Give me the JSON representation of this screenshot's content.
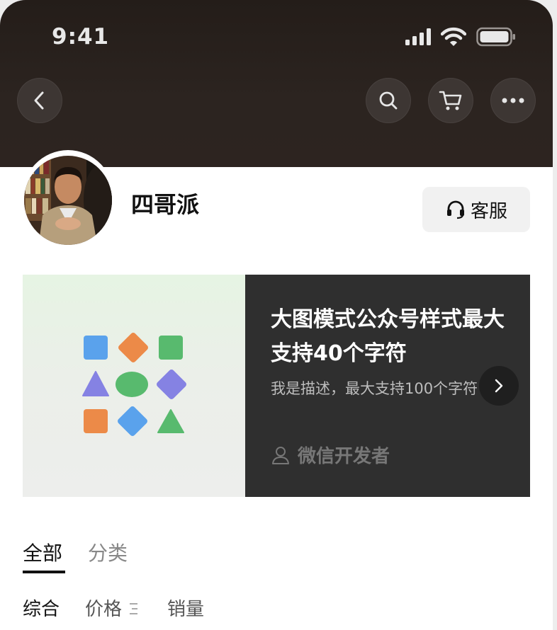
{
  "status_bar": {
    "time": "9:41"
  },
  "nav": {
    "back_icon": "chevron-left-icon",
    "search_icon": "search-icon",
    "cart_icon": "cart-icon",
    "more_icon": "more-icon"
  },
  "shop": {
    "name": "四哥派",
    "service_label": "客服"
  },
  "banner": {
    "title": "大图模式公众号样式最大支持40个字符",
    "description": "我是描述，最大支持100个字符",
    "author": "微信开发者"
  },
  "tabs": [
    {
      "label": "全部",
      "active": true
    },
    {
      "label": "分类",
      "active": false
    }
  ],
  "sort": {
    "comprehensive": "综合",
    "price": "价格",
    "sales": "销量"
  },
  "colors": {
    "header": "#2c2420",
    "banner_dark": "#2f2f2f",
    "shape_blue": "#5aa2ec",
    "shape_orange": "#ec8a48",
    "shape_green": "#58ba6e",
    "shape_purple": "#8582e3"
  }
}
